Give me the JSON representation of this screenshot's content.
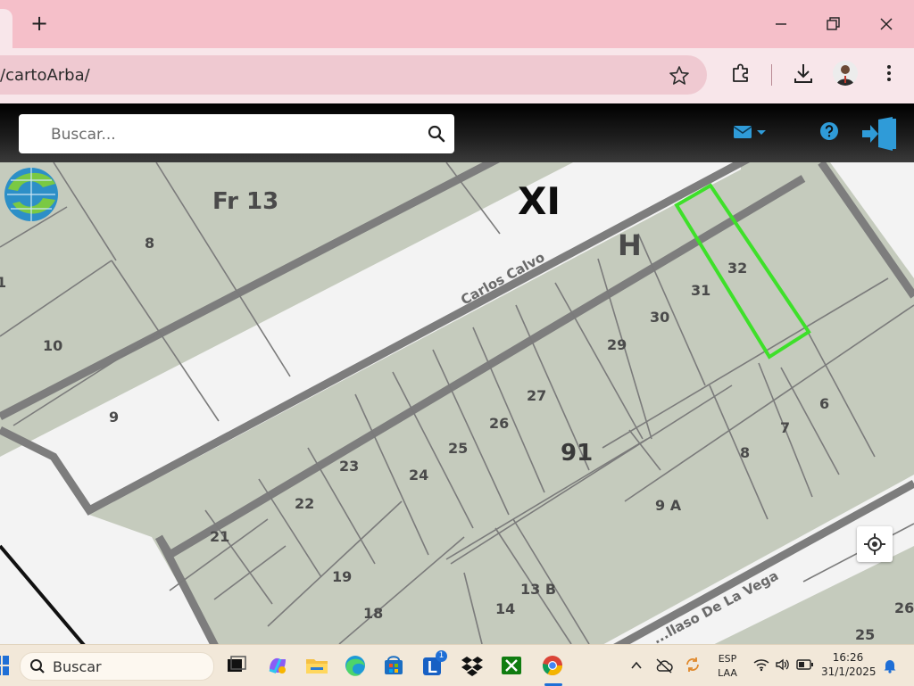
{
  "browser": {
    "address": "/cartoArba/",
    "new_tab_label": "+",
    "icons": [
      "new-tab-icon",
      "minimize-icon",
      "restore-icon",
      "close-icon",
      "bookmark-star-icon",
      "extensions-icon",
      "download-icon",
      "profile-avatar",
      "more-menu-icon"
    ]
  },
  "app": {
    "search_placeholder": "Buscar...",
    "accent": "#2f9bd8"
  },
  "map": {
    "zone_labels": {
      "fraction": "Fr 13",
      "circ": "XI",
      "section": "H",
      "block": "91"
    },
    "streets": {
      "top": "Carlos Calvo",
      "bottom": "...llaso De La Vega"
    },
    "parcels_top_block": [
      "8",
      "1",
      "10",
      "9"
    ],
    "parcels_block_h": [
      "32",
      "31",
      "30",
      "29"
    ],
    "parcels_block_91": [
      "27",
      "26",
      "25",
      "24",
      "23",
      "22",
      "21",
      "19",
      "18",
      "14",
      "13 B",
      "9 A",
      "8",
      "7",
      "6",
      "26",
      "25"
    ],
    "highlight_color": "#3ee02a"
  },
  "taskbar": {
    "search_label": "Buscar",
    "badge": "1",
    "lang_top": "ESP",
    "lang_bottom": "LAA",
    "time": "16:26",
    "date": "31/1/2025"
  }
}
